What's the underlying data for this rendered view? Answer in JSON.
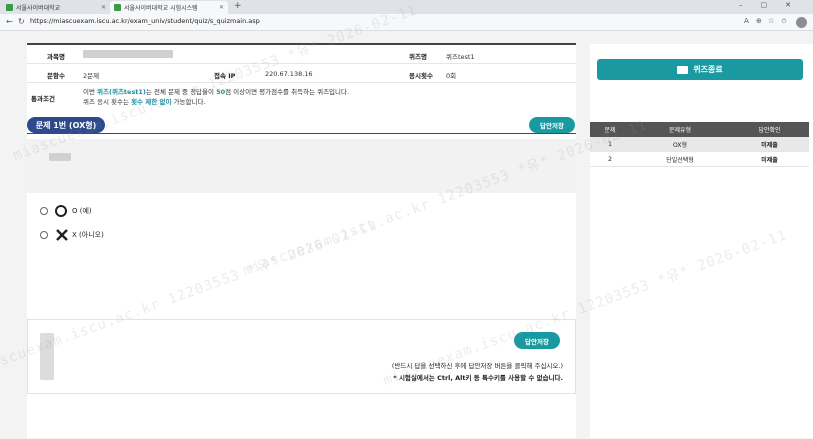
{
  "browser": {
    "tabs": [
      {
        "label": "서울사이버대학교"
      },
      {
        "label": "서울사이버대학교 시험시스템"
      }
    ],
    "url": "https://miascuexam.iscu.ac.kr/exam_univ/student/quiz/s_quizmain.asp",
    "text_size": "A"
  },
  "info": {
    "course_label": "과목명",
    "quiz_name_label": "퀴즈명",
    "quiz_name_value": "퀴즈test1",
    "question_count_label": "문항수",
    "question_count_value": "2문제",
    "ip_label": "접속 IP",
    "ip_value": "220.67.138.16",
    "attempt_label": "응시횟수",
    "attempt_value": "0회",
    "pass_label": "통과조건",
    "pass_line1_pre": "이번 ",
    "pass_line1_quiz": "퀴즈(퀴즈test1)",
    "pass_line1_mid": "는 전체 문제 중 정답율이 ",
    "pass_line1_score": "50",
    "pass_line1_post": "점 이상이면 평가점수를 취득하는 퀴즈입니다.",
    "pass_line2_pre": "퀴즈 응시 횟수는 ",
    "pass_line2_hl": "횟수 제한 없이",
    "pass_line2_post": " 가능합니다."
  },
  "question": {
    "badge": "문제 1번 (OX형)",
    "save_label": "답안저장",
    "options": [
      {
        "label": "O (예)"
      },
      {
        "label": "X (아니오)"
      }
    ]
  },
  "bottom": {
    "save_label": "답안저장",
    "note1": "(반드시 답을 선택하신 후에 답안저장 버튼을 클릭해 주십시오.)",
    "note2": "* 시험실에서는 Ctrl, Alt키 등 특수키를 사용할 수 없습니다."
  },
  "sidebar": {
    "end_label": "퀴즈종료",
    "table_headers": [
      "문제",
      "문제유형",
      "답안확인"
    ],
    "rows": [
      {
        "num": "1",
        "type": "OX형",
        "status": "미제출"
      },
      {
        "num": "2",
        "type": "단일선택형",
        "status": "미제출"
      }
    ]
  },
  "watermark": "miascuexam.iscu.ac.kr 12203553 *유* 2026-02-11",
  "colors": {
    "accent": "#1a9aa0",
    "badge": "#2c4a8c",
    "header": "#555555"
  }
}
